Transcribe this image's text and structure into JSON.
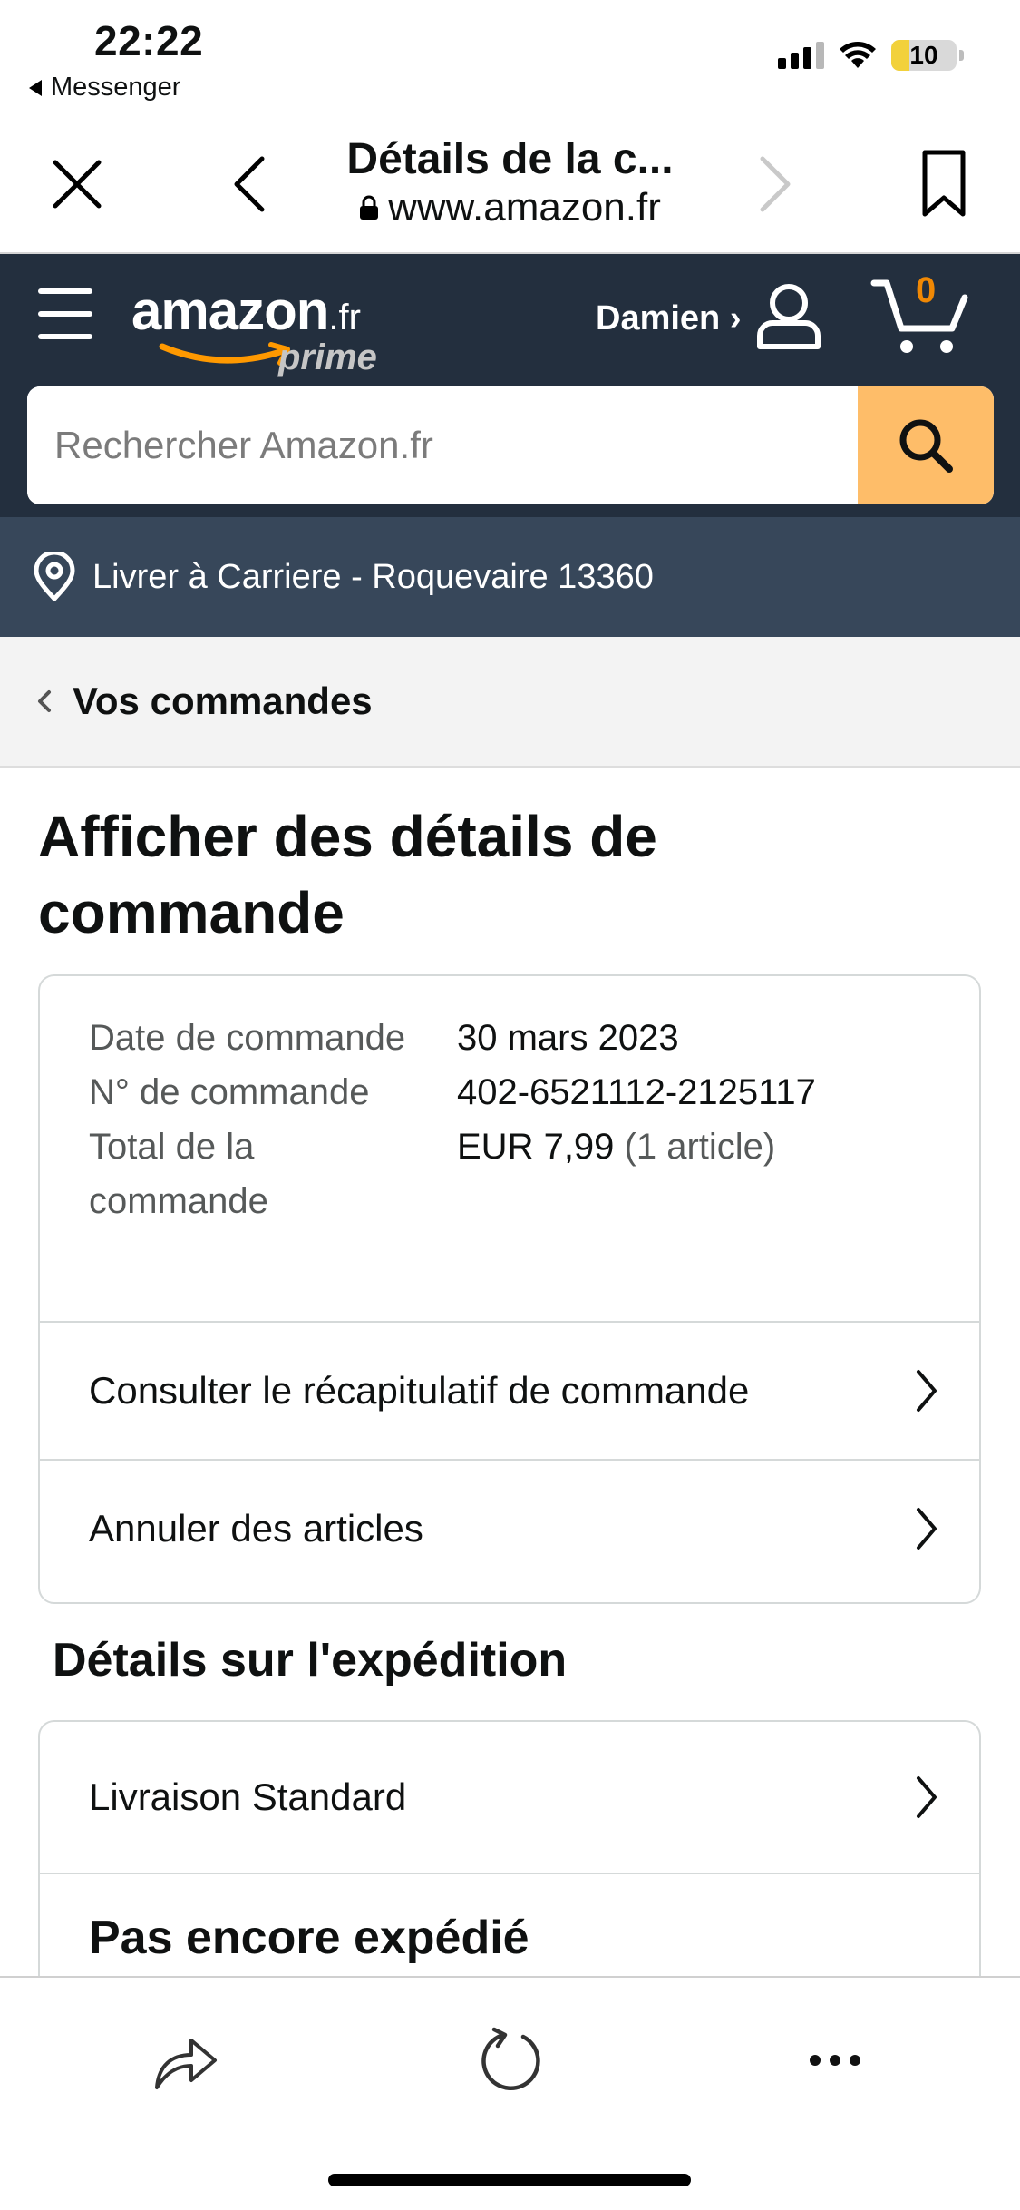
{
  "status_bar": {
    "time": "22:22",
    "back_app": "Messenger",
    "battery": "10"
  },
  "browser": {
    "title": "Détails de la c...",
    "url": "www.amazon.fr"
  },
  "header": {
    "logo_word": "amazon",
    "logo_tld": ".fr",
    "logo_sub": "prime",
    "account_label": "Damien ›",
    "cart_count": "0",
    "search_placeholder": "Rechercher Amazon.fr",
    "deliver_to": "Livrer à Carriere - Roquevaire 13360"
  },
  "breadcrumb": {
    "label": "Vos commandes"
  },
  "page": {
    "title": "Afficher des détails de commande"
  },
  "order": {
    "date_label": "Date de commande",
    "date_value": "30 mars 2023",
    "number_label": "N° de commande",
    "number_value": "402-6521112-2125117",
    "total_label": "Total de la commande",
    "total_value": "EUR 7,99",
    "total_items": "(1 article)"
  },
  "actions": {
    "summary": "Consulter le récapitulatif de commande",
    "cancel": "Annuler des articles"
  },
  "shipping": {
    "section_title": "Détails sur l'expédition",
    "method": "Livraison Standard",
    "status": "Pas encore expédié"
  },
  "colors": {
    "header_bg": "#232f3e",
    "deliver_bg": "#37475a",
    "search_button": "#febd69",
    "cart_badge": "#f08804"
  }
}
